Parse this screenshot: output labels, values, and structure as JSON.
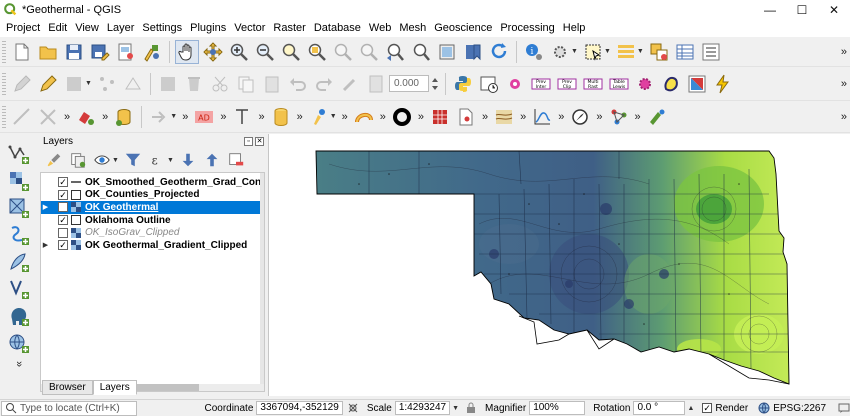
{
  "window": {
    "title": "*Geothermal - QGIS"
  },
  "menu": [
    "Project",
    "Edit",
    "View",
    "Layer",
    "Settings",
    "Plugins",
    "Vector",
    "Raster",
    "Database",
    "Web",
    "Mesh",
    "Geoscience",
    "Processing",
    "Help"
  ],
  "toolbar": {
    "rotation_value": "0.000",
    "label_tool_text": "AD"
  },
  "layers_panel": {
    "title": "Layers",
    "layers": [
      {
        "name": "OK_Smoothed_Geotherm_Grad_Contours",
        "checked": true,
        "symbol": "line",
        "selected": false,
        "enabled": true,
        "expandable": false
      },
      {
        "name": "OK_Counties_Projected",
        "checked": true,
        "symbol": "polygon",
        "selected": false,
        "enabled": true,
        "expandable": false
      },
      {
        "name": "OK Geothermal",
        "checked": true,
        "symbol": "raster",
        "selected": true,
        "enabled": true,
        "expandable": true
      },
      {
        "name": "Oklahoma Outline",
        "checked": true,
        "symbol": "polygon",
        "selected": false,
        "enabled": true,
        "expandable": false
      },
      {
        "name": "OK_IsoGrav_Clipped",
        "checked": false,
        "symbol": "raster",
        "selected": false,
        "enabled": false,
        "expandable": false
      },
      {
        "name": "OK Geothermal_Gradient_Clipped",
        "checked": true,
        "symbol": "raster",
        "selected": false,
        "enabled": true,
        "expandable": true
      }
    ],
    "tabs": [
      "Browser",
      "Layers"
    ],
    "active_tab": "Layers"
  },
  "status": {
    "locator_placeholder": "Type to locate (Ctrl+K)",
    "coordinate_label": "Coordinate",
    "coordinate_value": "3367094,-352129",
    "scale_label": "Scale",
    "scale_value": "1:4293247",
    "magnifier_label": "Magnifier",
    "magnifier_value": "100%",
    "rotation_label": "Rotation",
    "rotation_value": "0.0 °",
    "render_label": "Render",
    "crs": "EPSG:2267"
  },
  "colors": {
    "selection": "#0078d7",
    "map_low": "#3e5e88",
    "map_mid": "#4a8a82",
    "map_high": "#b3e436"
  }
}
